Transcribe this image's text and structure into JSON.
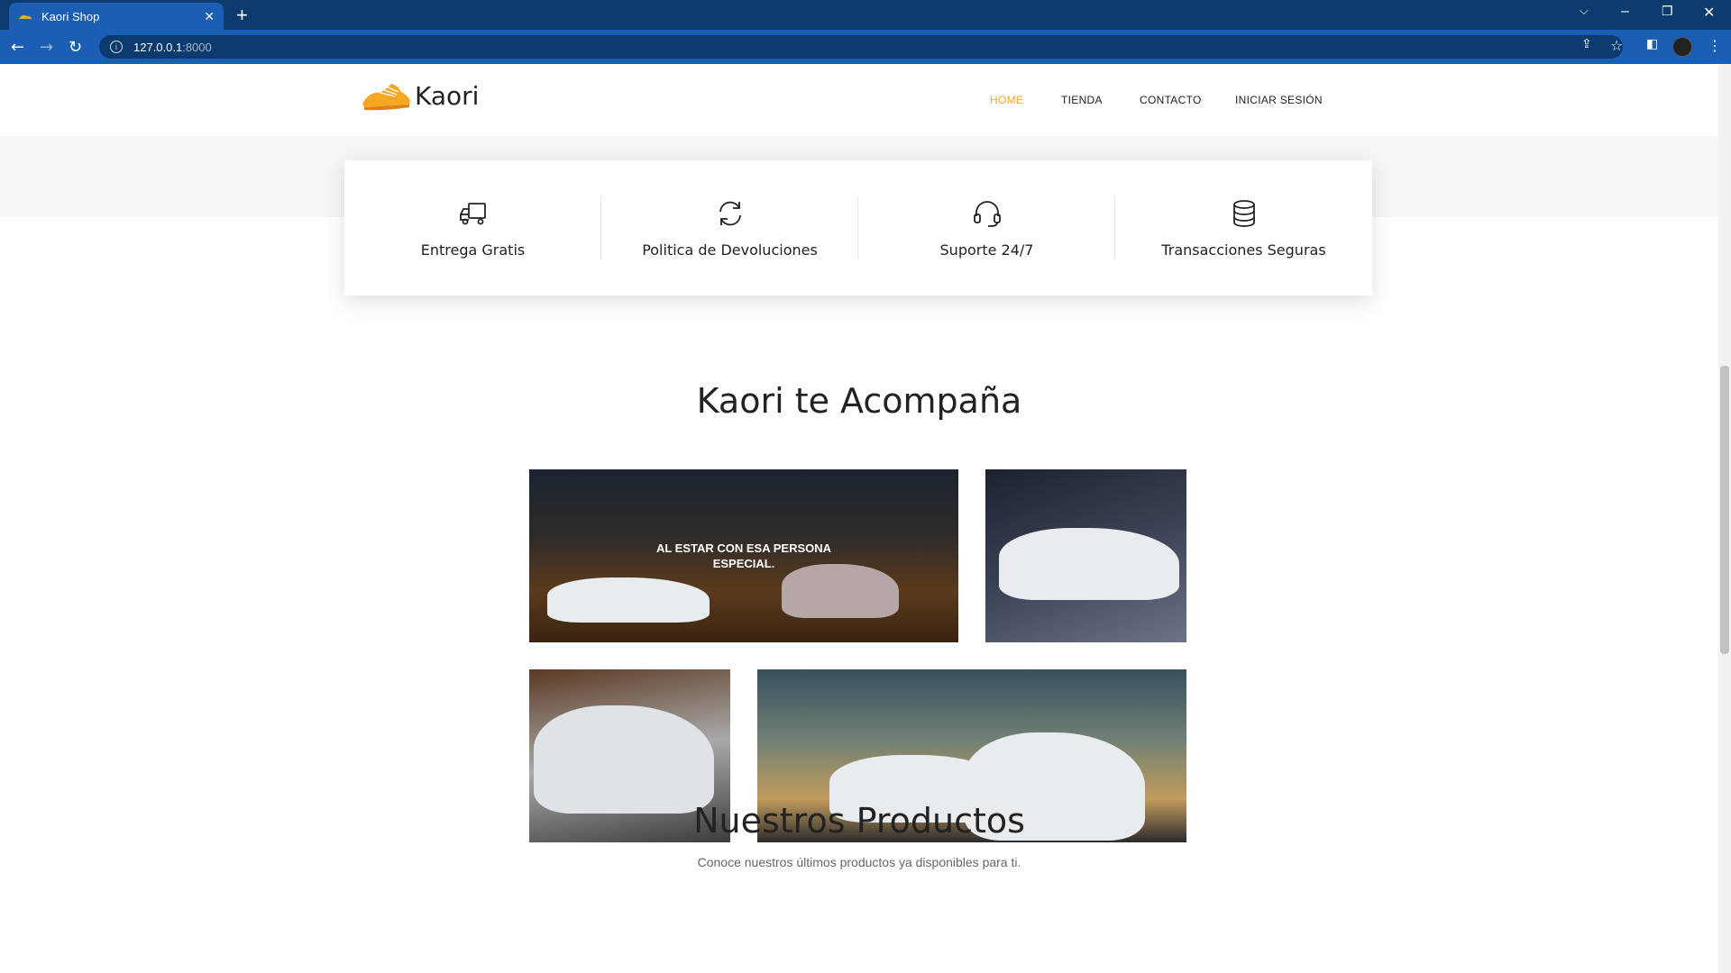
{
  "browser": {
    "tab_title": "Kaori Shop",
    "tab_close": "✕",
    "new_tab": "+",
    "url_host": "127.0.0.1",
    "url_port": ":8000",
    "win_minimize": "–",
    "win_restore": "❐",
    "win_close": "✕",
    "tab_search": "⌵"
  },
  "header": {
    "brand": "Kaori",
    "nav": [
      {
        "label": "HOME",
        "active": true
      },
      {
        "label": "TIENDA",
        "active": false
      },
      {
        "label": "CONTACTO",
        "active": false
      },
      {
        "label": "INICIAR SESIÓN",
        "active": false
      }
    ]
  },
  "features": [
    {
      "icon": "truck-icon",
      "label": "Entrega Gratis"
    },
    {
      "icon": "refresh-icon",
      "label": "Politica de Devoluciones"
    },
    {
      "icon": "headset-icon",
      "label": "Suporte 24/7"
    },
    {
      "icon": "database-icon",
      "label": "Transacciones Seguras"
    }
  ],
  "gallery": {
    "title": "Kaori te Acompaña",
    "overlay_text": "AL ESTAR CON ESA PERSONA ESPECIAL."
  },
  "products": {
    "title": "Nuestros Productos",
    "subtitle": "Conoce nuestros últimos productos ya disponibles para ti."
  },
  "colors": {
    "accent": "#f5a623",
    "browser_frame": "#0b3a6e",
    "browser_toolbar": "#1a5fb4"
  }
}
